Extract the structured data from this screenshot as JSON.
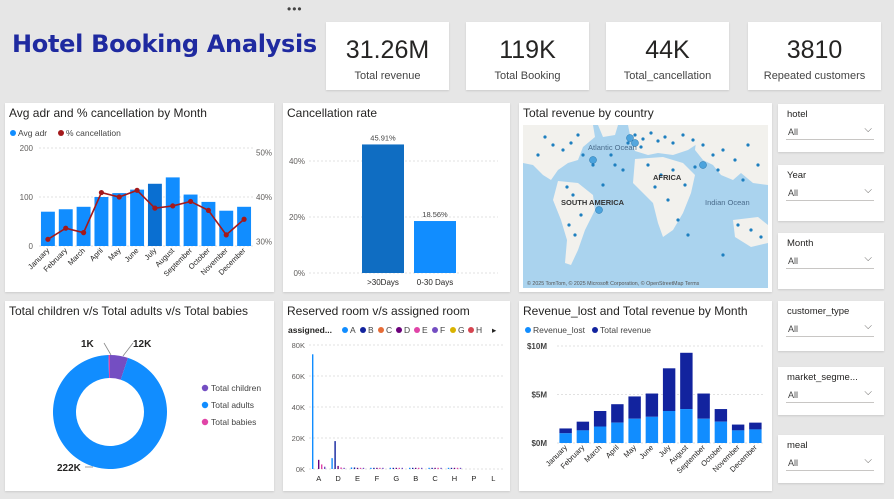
{
  "header": {
    "title": "Hotel Booking Analysis",
    "more_icon": "more-options-icon",
    "more_glyph": "•••"
  },
  "kpis": [
    {
      "value": "31.26M",
      "label": "Total revenue"
    },
    {
      "value": "119K",
      "label": "Total Booking"
    },
    {
      "value": "44K",
      "label": "Total_cancellation"
    },
    {
      "value": "3810",
      "label": "Repeated customers"
    }
  ],
  "slicers": [
    {
      "label": "hotel",
      "value": "All"
    },
    {
      "label": "Year",
      "value": "All"
    },
    {
      "label": "Month",
      "value": "All"
    },
    {
      "label": "customer_type",
      "value": "All"
    },
    {
      "label": "market_segme...",
      "value": "All"
    },
    {
      "label": "meal",
      "value": "All"
    }
  ],
  "slicer_chevron": "⌵",
  "visuals": {
    "adr": {
      "title": "Avg adr and % cancellation by Month",
      "legend": [
        "Avg adr",
        "% cancellation"
      ]
    },
    "cancel": {
      "title": "Cancellation rate"
    },
    "map": {
      "title": "Total revenue by country",
      "labels": [
        "Atlantic Ocean",
        "AFRICA",
        "SOUTH AMERICA",
        "Indian Ocean"
      ],
      "attribution": "© 2025 TomTom, © 2025 Microsoft Corporation, © OpenStreetMap Terms"
    },
    "guests": {
      "title": "Total children v/s Total adults v/s Total babies"
    },
    "rooms": {
      "title": "Reserved room v/s assigned room",
      "legend_title": "assigned...",
      "more_glyph": "▸"
    },
    "revenue": {
      "title": "Revenue_lost and Total revenue by Month",
      "legend": [
        "Revenue_lost",
        "Total revenue"
      ]
    }
  },
  "colors": {
    "primary_blue": "#118dff",
    "dark_blue": "#12239e",
    "line_red": "#a4191b",
    "purple": "#6b007b",
    "pink": "#e044a7",
    "title_blue": "#1f2aa0"
  },
  "chart_data": [
    {
      "id": "adr",
      "type": "bar",
      "title": "Avg adr and % cancellation by Month",
      "categories": [
        "January",
        "February",
        "March",
        "April",
        "May",
        "June",
        "July",
        "August",
        "September",
        "October",
        "November",
        "December"
      ],
      "series": [
        {
          "name": "Avg adr",
          "values": [
            70,
            75,
            80,
            100,
            108,
            115,
            127,
            140,
            105,
            90,
            72,
            80
          ]
        },
        {
          "name": "% cancellation",
          "values": [
            30.5,
            33,
            32,
            41,
            40,
            41.5,
            37.5,
            38,
            39,
            37,
            31.5,
            35
          ]
        }
      ],
      "highlight_index": 6,
      "y_ticks": [
        "0",
        "100",
        "200"
      ],
      "y2_ticks": [
        "30%",
        "40%",
        "50%"
      ],
      "ylim": [
        0,
        200
      ],
      "y2lim": [
        29,
        51
      ]
    },
    {
      "id": "cancel",
      "type": "bar",
      "title": "Cancellation rate",
      "categories": [
        ">30Days",
        "0-30 Days"
      ],
      "values": [
        45.91,
        18.56
      ],
      "data_labels": [
        "45.91%",
        "18.56%"
      ],
      "y_ticks": [
        "0%",
        "20%",
        "40%"
      ],
      "ylim": [
        0,
        50
      ]
    },
    {
      "id": "guests",
      "type": "pie",
      "title": "Total children v/s Total adults v/s Total babies",
      "labels": [
        "Total children",
        "Total adults",
        "Total babies"
      ],
      "values": [
        12,
        222,
        1
      ],
      "data_labels": [
        "12K",
        "222K",
        "1K"
      ],
      "colors": [
        "#744ec2",
        "#118dff",
        "#e044a7"
      ]
    },
    {
      "id": "rooms",
      "type": "bar",
      "title": "Reserved room v/s assigned room",
      "legend": [
        "A",
        "B",
        "C",
        "D",
        "E",
        "F",
        "G",
        "H"
      ],
      "legend_colors": [
        "#118dff",
        "#12239e",
        "#e66c37",
        "#6b007b",
        "#e044a7",
        "#744ec2",
        "#d9b300",
        "#d64550"
      ],
      "categories": [
        "A",
        "D",
        "E",
        "F",
        "G",
        "B",
        "C",
        "H",
        "P",
        "L"
      ],
      "series_values": [
        [
          74,
          7,
          1,
          0.5,
          0.3,
          0.2,
          0.1,
          0.1,
          0,
          0
        ],
        [
          0,
          18,
          1,
          0.5,
          0.3,
          0.2,
          0.1,
          0.1,
          0,
          0
        ]
      ],
      "y_ticks": [
        "0K",
        "20K",
        "40K",
        "60K",
        "80K"
      ],
      "ylim": [
        0,
        80
      ]
    },
    {
      "id": "revenue",
      "type": "bar",
      "title": "Revenue_lost and Total revenue by Month",
      "categories": [
        "January",
        "February",
        "March",
        "April",
        "May",
        "June",
        "July",
        "August",
        "September",
        "October",
        "November",
        "December"
      ],
      "series": [
        {
          "name": "Revenue_lost",
          "values": [
            1.0,
            1.3,
            1.7,
            2.1,
            2.5,
            2.7,
            3.3,
            3.5,
            2.5,
            2.2,
            1.3,
            1.4
          ]
        },
        {
          "name": "Total revenue",
          "values": [
            1.5,
            2.2,
            3.3,
            4.0,
            4.8,
            5.1,
            7.7,
            9.3,
            5.1,
            3.5,
            1.9,
            2.1
          ]
        }
      ],
      "y_ticks": [
        "$0M",
        "$5M",
        "$10M"
      ],
      "ylim": [
        0,
        10
      ]
    }
  ]
}
